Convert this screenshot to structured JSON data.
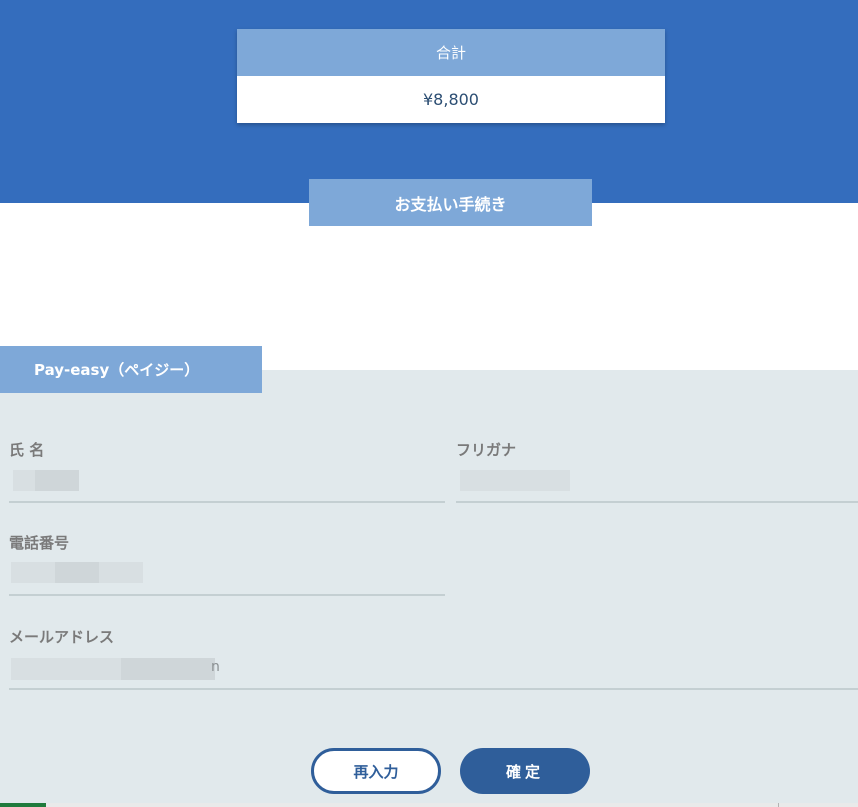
{
  "summary": {
    "total_label": "合計",
    "total_amount": "¥8,800"
  },
  "procedure_tab": "お支払い手続き",
  "payment_method_tab": "Pay-easy（ペイジー）",
  "form": {
    "name_label": "氏 名",
    "furigana_label": "フリガナ",
    "phone_label": "電話番号",
    "email_label": "メールアドレス",
    "email_tail_char": "n"
  },
  "buttons": {
    "reenter": "再入力",
    "confirm": "確定"
  },
  "colors": {
    "header_blue": "#346dbd",
    "tab_blue": "#7ea8d8",
    "button_blue": "#2f5e9a",
    "panel_gray": "#e1e9ec"
  }
}
